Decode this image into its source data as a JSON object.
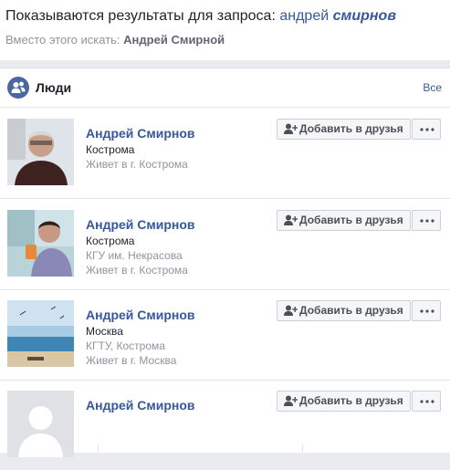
{
  "search": {
    "prefix": "Показываются результаты для запроса:",
    "term_plain": "андрей",
    "term_bold": "смирнов",
    "alt_prefix": "Вместо этого искать:",
    "alt_term": "Андрей Смирной"
  },
  "people": {
    "title": "Люди",
    "see_all": "Все",
    "add_label": "Добавить в друзья",
    "results": [
      {
        "name": "Андрей Смирнов",
        "line1": "Кострома",
        "line2": "Живет в г. Кострома",
        "line3": ""
      },
      {
        "name": "Андрей Смирнов",
        "line1": "Кострома",
        "line2": "КГУ им. Некрасова",
        "line3": "Живет в г. Кострома"
      },
      {
        "name": "Андрей Смирнов",
        "line1": "Москва",
        "line2": "КГТУ, Кострома",
        "line3": "Живет в г. Москва"
      },
      {
        "name": "Андрей Смирнов",
        "line1": "",
        "line2": "",
        "line3": ""
      }
    ]
  },
  "colors": {
    "link": "#365899",
    "accent": "#4b67a1",
    "muted": "#90949c"
  },
  "icons": [
    "people-icon",
    "add-friend-icon",
    "more-icon",
    "profile-photo",
    "default-avatar"
  ]
}
